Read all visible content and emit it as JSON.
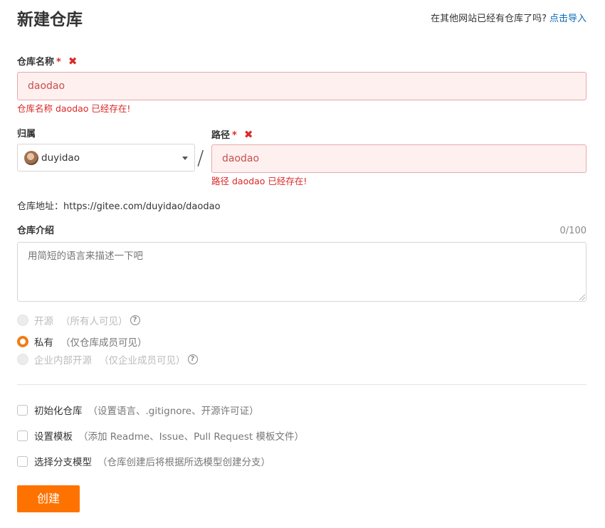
{
  "header": {
    "title": "新建仓库",
    "import_hint": "在其他网站已经有仓库了吗?",
    "import_link": "点击导入"
  },
  "repo_name": {
    "label": "仓库名称",
    "required_mark": "*",
    "error_icon": "✖",
    "value": "daodao",
    "error": "仓库名称 daodao 已经存在!"
  },
  "owner": {
    "label": "归属",
    "value": "duyidao",
    "avatar_icon": "user-avatar"
  },
  "separator": "/",
  "path": {
    "label": "路径",
    "required_mark": "*",
    "error_icon": "✖",
    "value": "daodao",
    "error": "路径 daodao 已经存在!"
  },
  "repo_url": "仓库地址：https://gitee.com/duyidao/daodao",
  "description": {
    "label": "仓库介绍",
    "counter": "0/100",
    "placeholder": "用简短的语言来描述一下吧"
  },
  "visibility": {
    "options": [
      {
        "label": "开源",
        "note": "（所有人可见）",
        "selected": false,
        "disabled": true,
        "help": true
      },
      {
        "label": "私有",
        "note": "（仅仓库成员可见）",
        "selected": true,
        "disabled": false,
        "help": false
      },
      {
        "label": "企业内部开源",
        "note": "（仅企业成员可见）",
        "selected": false,
        "disabled": true,
        "help": true
      }
    ],
    "help_glyph": "?"
  },
  "options": [
    {
      "label": "初始化仓库",
      "note": "（设置语言、.gitignore、开源许可证）",
      "checked": false
    },
    {
      "label": "设置模板",
      "note": "（添加 Readme、Issue、Pull Request 模板文件）",
      "checked": false
    },
    {
      "label": "选择分支模型",
      "note": "（仓库创建后将根据所选模型创建分支）",
      "checked": false
    }
  ],
  "submit_label": "创建",
  "colors": {
    "accent": "#fe7300",
    "error": "#db2828",
    "link": "#0a69b5"
  }
}
